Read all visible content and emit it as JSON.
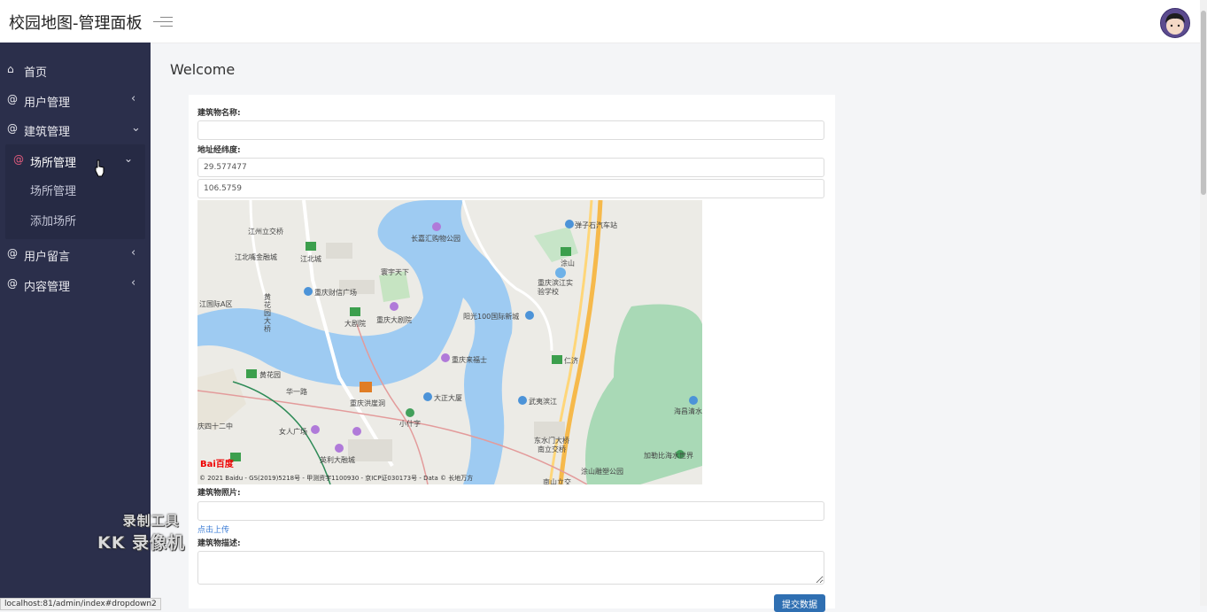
{
  "header": {
    "title": "校园地图-管理面板"
  },
  "sidebar": {
    "items": [
      {
        "label": "首页",
        "icon": "home-icon"
      },
      {
        "label": "用户管理",
        "icon": "at-icon"
      },
      {
        "label": "建筑管理",
        "icon": "at-icon"
      },
      {
        "label": "场所管理",
        "icon": "at-icon"
      },
      {
        "label": "用户留言",
        "icon": "at-icon"
      },
      {
        "label": "内容管理",
        "icon": "at-icon"
      }
    ],
    "sub_items": [
      "场所管理",
      "添加场所"
    ]
  },
  "main": {
    "title": "Welcome",
    "form": {
      "name_label": "建筑物名称:",
      "name_value": "",
      "coords_label": "地址经纬度:",
      "latitude": "29.577477",
      "longitude": "106.5759",
      "photo_label": "建筑物照片:",
      "upload_link": "点击上传",
      "desc_label": "建筑物描述:",
      "submit_label": "提交数据"
    },
    "map": {
      "labels": [
        {
          "text": "江州立交桥"
        },
        {
          "text": "江北嘴金融城"
        },
        {
          "text": "江北城"
        },
        {
          "text": "重庆财信广场"
        },
        {
          "text": "寰宇天下"
        },
        {
          "text": "长嘉汇购物公园"
        },
        {
          "text": "弹子石汽车站"
        },
        {
          "text": "涂山"
        },
        {
          "text": "重庆滨江实验学校"
        },
        {
          "text": "阳光100国际新城"
        },
        {
          "text": "重庆大剧院"
        },
        {
          "text": "大剧院"
        },
        {
          "text": "江国际A区"
        },
        {
          "text": "黄花园大桥"
        },
        {
          "text": "重庆来福士"
        },
        {
          "text": "仁济"
        },
        {
          "text": "黄花园"
        },
        {
          "text": "华一路"
        },
        {
          "text": "重庆洪崖洞"
        },
        {
          "text": "大正大厦"
        },
        {
          "text": "小什字"
        },
        {
          "text": "武夷滨江"
        },
        {
          "text": "海昌清水"
        },
        {
          "text": "庆四十二中"
        },
        {
          "text": "女人广场"
        },
        {
          "text": "东水门大桥"
        },
        {
          "text": "南立交桥"
        },
        {
          "text": "英利大融城"
        },
        {
          "text": "加勒比海水世界"
        },
        {
          "text": "涂山雕塑公园"
        },
        {
          "text": "南山立交"
        }
      ],
      "copyright": "© 2021 Baidu - GS(2019)5218号 - 甲测资字1100930 - 京ICP证030173号 - Data © 长地万方",
      "logo": "Bai百度"
    }
  },
  "watermark": {
    "line1": "录制工具",
    "line2": "KK 录像机"
  },
  "status_url": "localhost:81/admin/index#dropdown2"
}
